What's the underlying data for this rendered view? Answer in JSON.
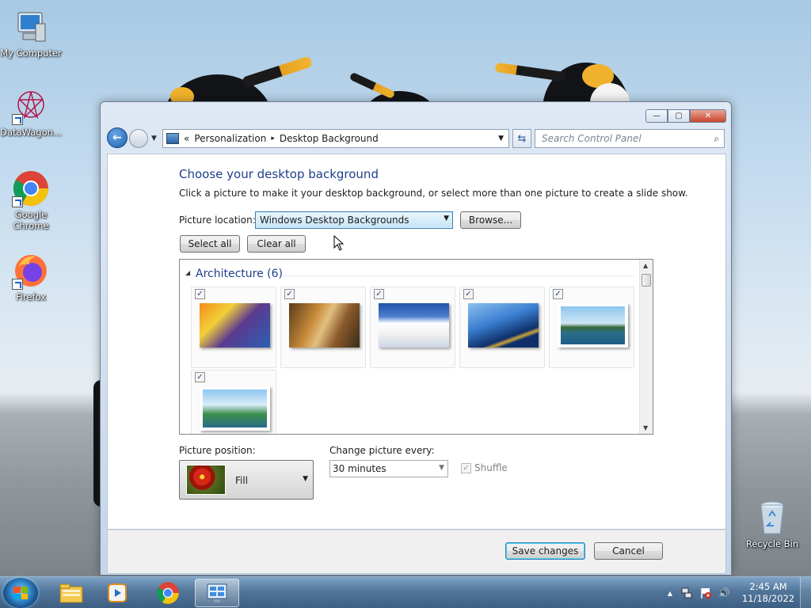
{
  "desktop": {
    "icons": [
      {
        "label": "My Computer",
        "icon": "computer-icon"
      },
      {
        "label": "DataWagon...",
        "icon": "datawagon-icon"
      },
      {
        "label": "Google Chrome",
        "icon": "chrome-icon"
      },
      {
        "label": "Firefox",
        "icon": "firefox-icon"
      },
      {
        "label": "Recycle Bin",
        "icon": "recycle-bin-icon"
      }
    ]
  },
  "window": {
    "caption_buttons": {
      "minimize": "—",
      "maximize": "▢",
      "close": "✕"
    },
    "address": {
      "prefix": "«",
      "crumb1": "Personalization",
      "separator": "▸",
      "crumb2": "Desktop Background"
    },
    "search_placeholder": "Search Control Panel",
    "title": "Choose your desktop background",
    "description": "Click a picture to make it your desktop background, or select more than one picture to create a slide show.",
    "picture_location_label": "Picture location:",
    "picture_location_value": "Windows Desktop Backgrounds",
    "browse_button": "Browse...",
    "select_all_button": "Select all",
    "clear_all_button": "Clear all",
    "gallery": {
      "group_label": "Architecture (6)",
      "group_toggle": "◢",
      "items": [
        {
          "checked": "✓",
          "colors": [
            "#f28a1b",
            "#5b3a8e",
            "#2b5fb4"
          ]
        },
        {
          "checked": "✓",
          "colors": [
            "#c98b3a",
            "#5a3a1a",
            "#e2c080"
          ]
        },
        {
          "checked": "✓",
          "colors": [
            "#ffffff",
            "#4d7fd0",
            "#2352a8"
          ]
        },
        {
          "checked": "✓",
          "colors": [
            "#3b7fd0",
            "#0f2f6a",
            "#c9a43a"
          ]
        },
        {
          "checked": "✓",
          "colors": [
            "#8fc6ee",
            "#2c6d8a",
            "#3a6a3a"
          ]
        },
        {
          "checked": "✓",
          "colors": [
            "#8fc6ee",
            "#3b8f4a",
            "#2a6a8a"
          ]
        }
      ]
    },
    "picture_position_label": "Picture position:",
    "picture_position_value": "Fill",
    "change_every_label": "Change picture every:",
    "change_every_value": "30 minutes",
    "shuffle_label": "Shuffle",
    "shuffle_checked": "✓",
    "save_button": "Save changes",
    "cancel_button": "Cancel"
  },
  "taskbar": {
    "items": [
      "explorer-icon",
      "media-player-icon",
      "chrome-icon",
      "control-panel-icon"
    ],
    "time": "2:45 AM",
    "date": "11/18/2022",
    "tray_expand": "▲",
    "volume": "🔊"
  }
}
